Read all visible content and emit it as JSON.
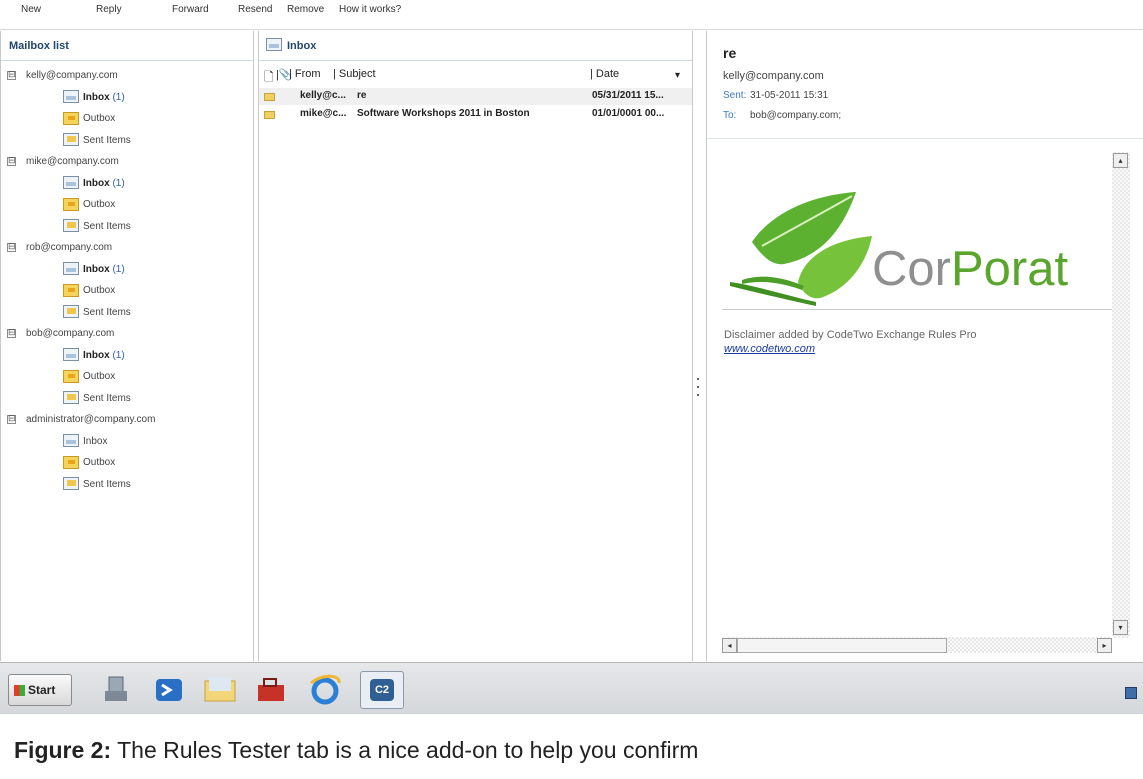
{
  "toolbar": {
    "items": [
      "New",
      "Reply",
      "Forward",
      "Resend",
      "Remove",
      "How it works?"
    ]
  },
  "mailbox_list": {
    "title": "Mailbox list",
    "accounts": [
      {
        "email": "kelly@company.com",
        "expander": "⊟",
        "folders": [
          {
            "name": "Inbox",
            "count": "(1)",
            "type": "inbox",
            "bold": true
          },
          {
            "name": "Outbox",
            "type": "outbox"
          },
          {
            "name": "Sent Items",
            "type": "sent"
          }
        ]
      },
      {
        "email": "mike@company.com",
        "expander": "⊟",
        "folders": [
          {
            "name": "Inbox",
            "count": "(1)",
            "type": "inbox",
            "bold": true
          },
          {
            "name": "Outbox",
            "type": "outbox"
          },
          {
            "name": "Sent Items",
            "type": "sent"
          }
        ]
      },
      {
        "email": "rob@company.com",
        "expander": "⊟",
        "folders": [
          {
            "name": "Inbox",
            "count": "(1)",
            "type": "inbox",
            "bold": true
          },
          {
            "name": "Outbox",
            "type": "outbox"
          },
          {
            "name": "Sent Items",
            "type": "sent"
          }
        ]
      },
      {
        "email": "bob@company.com",
        "expander": "⊟",
        "folders": [
          {
            "name": "Inbox",
            "count": "(1)",
            "type": "inbox",
            "bold": true
          },
          {
            "name": "Outbox",
            "type": "outbox"
          },
          {
            "name": "Sent Items",
            "type": "sent"
          }
        ]
      },
      {
        "email": "administrator@company.com",
        "expander": "⊟",
        "folders": [
          {
            "name": "Inbox",
            "type": "inbox"
          },
          {
            "name": "Outbox",
            "type": "outbox"
          },
          {
            "name": "Sent Items",
            "type": "sent"
          }
        ]
      }
    ]
  },
  "inbox": {
    "title": "Inbox",
    "columns": {
      "from": "| From",
      "subject": "| Subject",
      "date": "| Date",
      "sort_arrow": "▾"
    },
    "messages": [
      {
        "from": "kelly@c...",
        "subject": "re",
        "date": "05/31/2011 15..."
      },
      {
        "from": "mike@c...",
        "subject": "Software Workshops 2011 in Boston",
        "date": "01/01/0001 00..."
      }
    ]
  },
  "reading": {
    "subject": "re",
    "from": "kelly@company.com",
    "sent_label": "Sent:",
    "sent_value": "31-05-2011 15:31",
    "to_label": "To:",
    "to_value": "bob@company.com;",
    "logo_text_grey": "Cor",
    "logo_text_green": "Porat",
    "disclaimer": "Disclaimer added by CodeTwo Exchange Rules Pro",
    "link": "www.codetwo.com",
    "colors": {
      "logo_grey": "#8f8f8f",
      "logo_green": "#5aa52c",
      "link": "#1a3a9c"
    }
  },
  "taskbar": {
    "start_label": "Start",
    "buttons": [
      "server-manager-icon",
      "powershell-icon",
      "explorer-icon",
      "toolbox-icon",
      "internet-explorer-icon",
      "codetwo-icon"
    ],
    "active_label": "C2"
  },
  "caption": {
    "label": "Figure 2:",
    "text": "The Rules Tester tab is a nice add-on to help you confirm"
  }
}
